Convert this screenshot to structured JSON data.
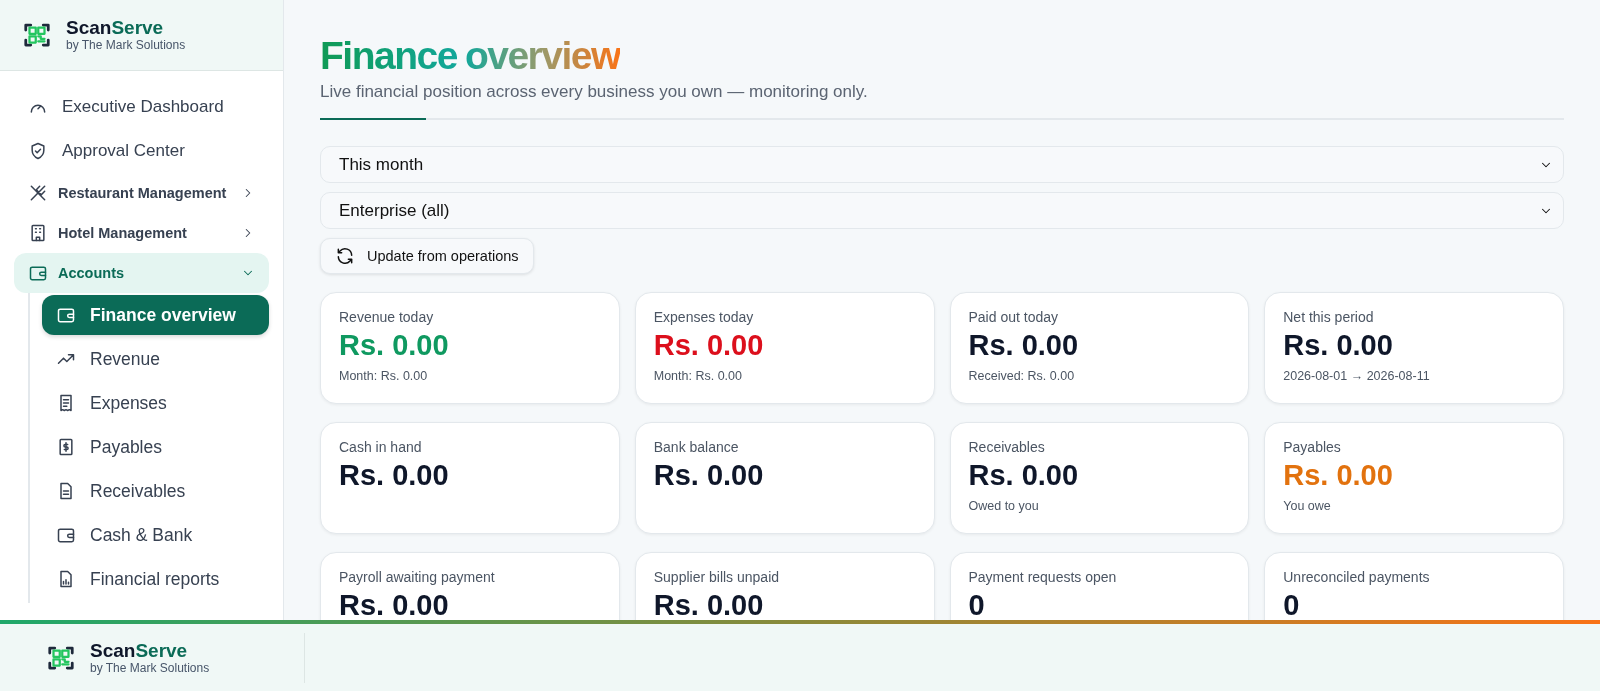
{
  "brand": {
    "name_part_1": "Scan",
    "name_part_2": "Serve",
    "byline": "by The Mark Solutions"
  },
  "sidebar": {
    "items": [
      {
        "label": "Executive Dashboard",
        "kind": "link",
        "selected": false
      },
      {
        "label": "Approval Center",
        "kind": "link",
        "selected": false
      },
      {
        "label": "Restaurant Management",
        "kind": "group",
        "expanded": false,
        "selected": false
      },
      {
        "label": "Hotel Management",
        "kind": "group",
        "expanded": false,
        "selected": false
      },
      {
        "label": "Accounts",
        "kind": "group",
        "expanded": true,
        "selected": true,
        "children": [
          {
            "label": "Finance overview",
            "selected": true
          },
          {
            "label": "Revenue",
            "selected": false
          },
          {
            "label": "Expenses",
            "selected": false
          },
          {
            "label": "Payables",
            "selected": false
          },
          {
            "label": "Receivables",
            "selected": false
          },
          {
            "label": "Cash & Bank",
            "selected": false
          },
          {
            "label": "Financial reports",
            "selected": false
          }
        ]
      }
    ]
  },
  "page": {
    "title_part_1": "Finance",
    "title_part_2": "overview",
    "subtitle": "Live financial position across every business you own — monitoring only.",
    "period_select": {
      "value": "This month"
    },
    "scope_select": {
      "value": "Enterprise (all)"
    },
    "update_button": "Update from operations"
  },
  "cards": [
    {
      "label": "Revenue today",
      "value": "Rs. 0.00",
      "color": "#0f9960",
      "note": "Month: Rs. 0.00"
    },
    {
      "label": "Expenses today",
      "value": "Rs. 0.00",
      "color": "#dc0f1c",
      "note": "Month: Rs. 0.00"
    },
    {
      "label": "Paid out today",
      "value": "Rs. 0.00",
      "color": "#0f172a",
      "note": "Received: Rs. 0.00"
    },
    {
      "label": "Net this period",
      "value": "Rs. 0.00",
      "color": "#0f172a",
      "note": "2026-08-01 → 2026-08-11"
    },
    {
      "label": "Cash in hand",
      "value": "Rs. 0.00",
      "color": "#0f172a"
    },
    {
      "label": "Bank balance",
      "value": "Rs. 0.00",
      "color": "#0f172a"
    },
    {
      "label": "Receivables",
      "value": "Rs. 0.00",
      "color": "#0f172a",
      "note": "Owed to you"
    },
    {
      "label": "Payables",
      "value": "Rs. 0.00",
      "color": "#e2720e",
      "note": "You owe"
    },
    {
      "label": "Payroll awaiting payment",
      "value": "Rs. 0.00",
      "color": "#0f172a"
    },
    {
      "label": "Supplier bills unpaid",
      "value": "Rs. 0.00",
      "color": "#0f172a"
    },
    {
      "label": "Payment requests open",
      "value": "0",
      "color": "#0f172a"
    },
    {
      "label": "Unreconciled payments",
      "value": "0",
      "color": "#0f172a"
    }
  ],
  "footer": {
    "name_part_1": "Scan",
    "name_part_2": "Serve",
    "byline": "by The Mark Solutions"
  }
}
